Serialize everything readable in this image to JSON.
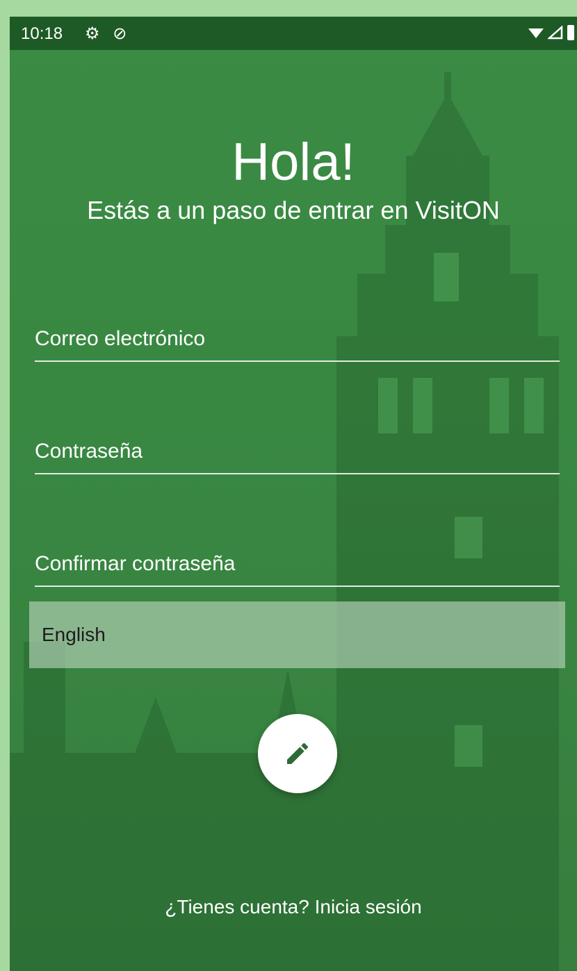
{
  "status_bar": {
    "time": "10:18",
    "icons_left": [
      "settings-icon",
      "data-saver-icon"
    ],
    "icons_right": [
      "wifi-icon",
      "signal-icon",
      "battery-icon"
    ]
  },
  "header": {
    "title": "Hola!",
    "subtitle": "Estás a un paso de entrar en VisitON"
  },
  "form": {
    "email_placeholder": "Correo electrónico",
    "password_placeholder": "Contraseña",
    "confirm_placeholder": "Confirmar contraseña",
    "language_selected": "English"
  },
  "actions": {
    "fab_icon": "edit-pencil-icon",
    "login_link": "¿Tienes cuenta? Inicia sesión"
  },
  "colors": {
    "background": "#398842",
    "status_bar": "#1e5a25",
    "outer_frame": "#a6d9a0"
  }
}
